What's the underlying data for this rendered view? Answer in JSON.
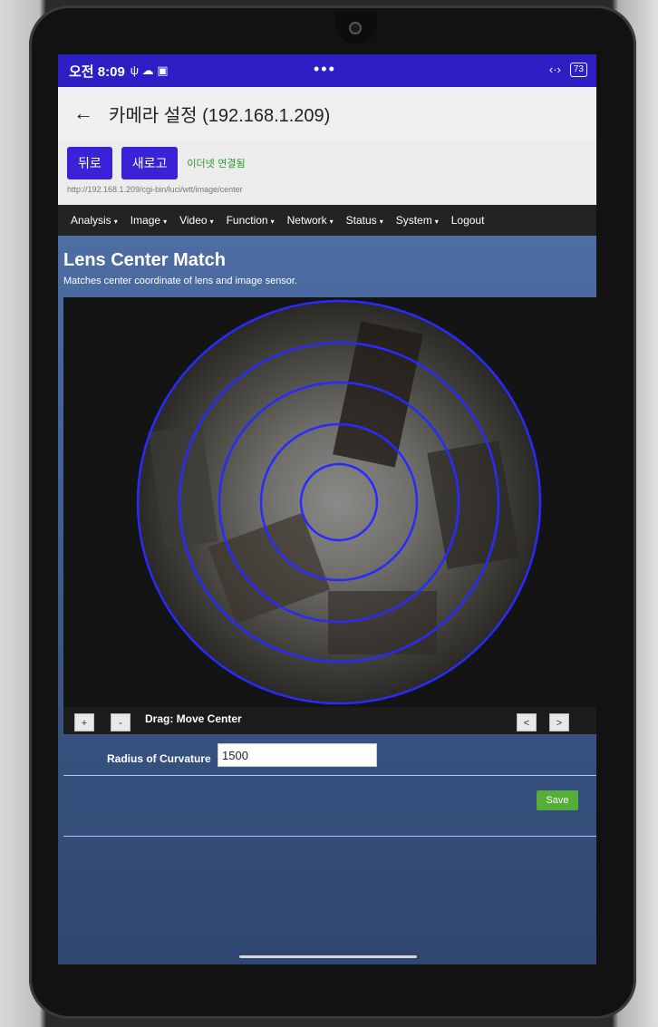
{
  "statusbar": {
    "time": "오전 8:09",
    "notif_icons": "ψ ☁ ▣",
    "dots": "•••",
    "link_icon": "‹·›",
    "battery": "73"
  },
  "appbar": {
    "back_icon": "←",
    "title": "카메라 설정 (192.168.1.209)"
  },
  "toolbar": {
    "back_label": "뒤로",
    "refresh_label": "새로고",
    "connection_status": "이더넷 연결됨",
    "url": "http://192.168.1.209/cgi-bin/luci/wtt/image/center"
  },
  "nav": {
    "items": [
      "Analysis",
      "Image",
      "Video",
      "Function",
      "Network",
      "Status",
      "System"
    ],
    "caret": "▾",
    "logout": "Logout"
  },
  "page": {
    "title": "Lens Center Match",
    "subtitle": "Matches center coordinate of lens and image sensor."
  },
  "controls": {
    "plus": "+",
    "minus": "-",
    "drag_label": "Drag: Move Center",
    "prev": "<",
    "next": ">"
  },
  "form": {
    "radius_label": "Radius of Curvature",
    "radius_value": "1500"
  },
  "save_label": "Save",
  "colors": {
    "accent": "#3a22d6",
    "ring": "#2a2aff",
    "save": "#56ad39",
    "statusbar": "#2d1fc4"
  }
}
